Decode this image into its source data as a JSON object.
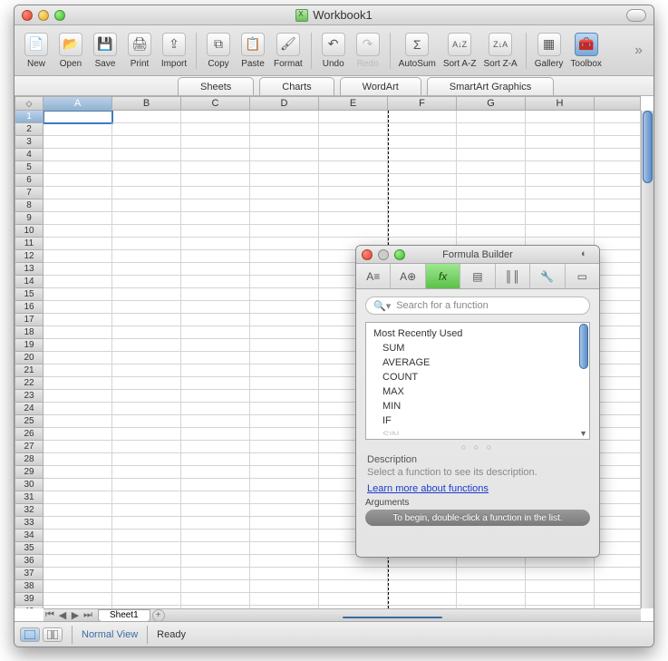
{
  "window": {
    "title": "Workbook1"
  },
  "toolbar": {
    "items": [
      {
        "label": "New"
      },
      {
        "label": "Open"
      },
      {
        "label": "Save"
      },
      {
        "label": "Print"
      },
      {
        "label": "Import"
      },
      {
        "label": "Copy"
      },
      {
        "label": "Paste"
      },
      {
        "label": "Format"
      },
      {
        "label": "Undo"
      },
      {
        "label": "Redo"
      },
      {
        "label": "AutoSum"
      },
      {
        "label": "Sort A-Z"
      },
      {
        "label": "Sort Z-A"
      },
      {
        "label": "Gallery"
      },
      {
        "label": "Toolbox"
      }
    ]
  },
  "ribbon": {
    "tabs": [
      "Sheets",
      "Charts",
      "WordArt",
      "SmartArt Graphics"
    ]
  },
  "grid": {
    "columns": [
      "A",
      "B",
      "C",
      "D",
      "E",
      "F",
      "G",
      "H"
    ],
    "row_count": 43,
    "active_cell": "A1"
  },
  "sheet": {
    "name": "Sheet1"
  },
  "status": {
    "view": "Normal View",
    "state": "Ready"
  },
  "formula_builder": {
    "title": "Formula Builder",
    "tabs_icons": [
      "ref",
      "add",
      "fx",
      "book",
      "lib",
      "wrench",
      "box"
    ],
    "search_placeholder": "Search for a function",
    "list_header": "Most Recently Used",
    "functions": [
      "SUM",
      "AVERAGE",
      "COUNT",
      "MAX",
      "MIN",
      "IF",
      "SIN"
    ],
    "description_label": "Description",
    "description_text": "Select a function to see its description.",
    "learn_more": "Learn more about functions",
    "arguments_label": "Arguments",
    "arguments_hint": "To begin, double-click a function in the list."
  }
}
